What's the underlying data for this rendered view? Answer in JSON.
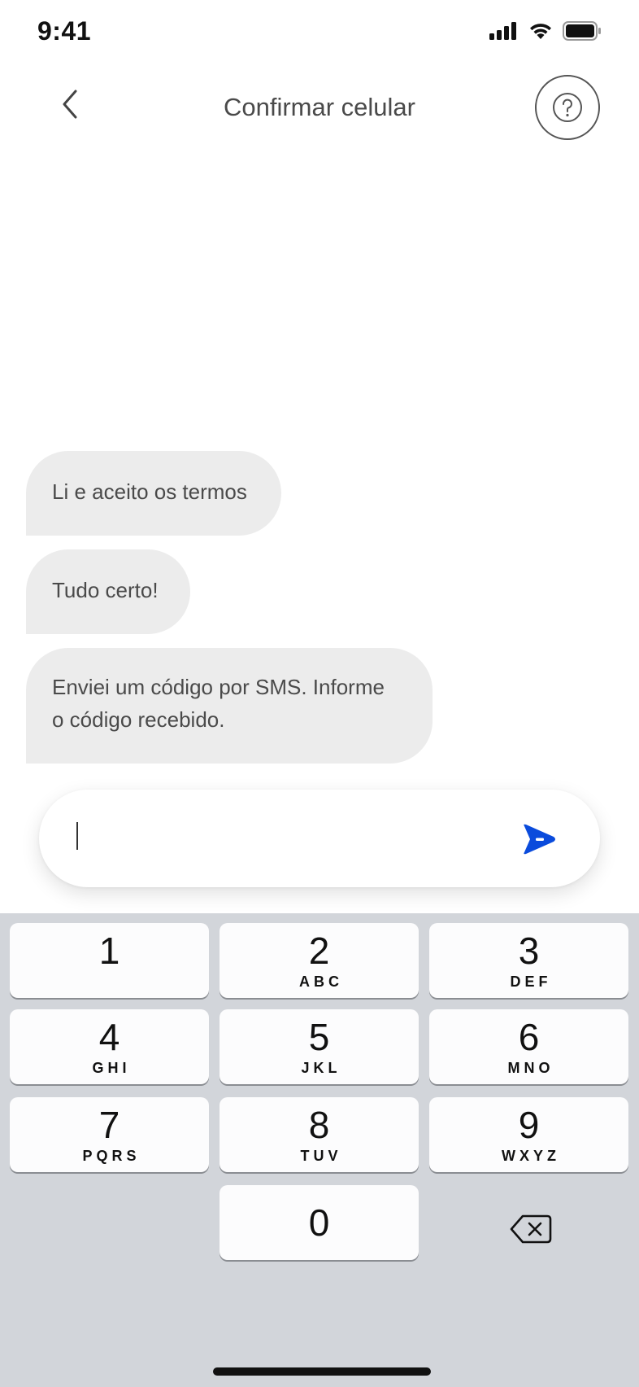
{
  "status_bar": {
    "time": "9:41",
    "icons": [
      "signal-icon",
      "wifi-icon",
      "battery-icon"
    ]
  },
  "nav": {
    "title": "Confirmar celular",
    "back_icon": "chevron-left-icon",
    "help_icon": "question-icon"
  },
  "messages": [
    {
      "text": "Li e aceito os termos"
    },
    {
      "text": "Tudo certo!"
    },
    {
      "line1": "Enviei um código por SMS. Informe",
      "line2": "o código recebido."
    }
  ],
  "input": {
    "value": "",
    "placeholder": "",
    "send_icon": "send-icon"
  },
  "keyboard": {
    "keys": [
      {
        "digit": "1",
        "letters": ""
      },
      {
        "digit": "2",
        "letters": "ABC"
      },
      {
        "digit": "3",
        "letters": "DEF"
      },
      {
        "digit": "4",
        "letters": "GHI"
      },
      {
        "digit": "5",
        "letters": "JKL"
      },
      {
        "digit": "6",
        "letters": "MNO"
      },
      {
        "digit": "7",
        "letters": "PQRS"
      },
      {
        "digit": "8",
        "letters": "TUV"
      },
      {
        "digit": "9",
        "letters": "WXYZ"
      },
      {
        "digit": "0",
        "letters": ""
      }
    ],
    "delete_icon": "backspace-icon"
  },
  "colors": {
    "accent": "#0a4bdc",
    "bubble": "#ececec",
    "keyboard_bg": "#d2d5da"
  }
}
